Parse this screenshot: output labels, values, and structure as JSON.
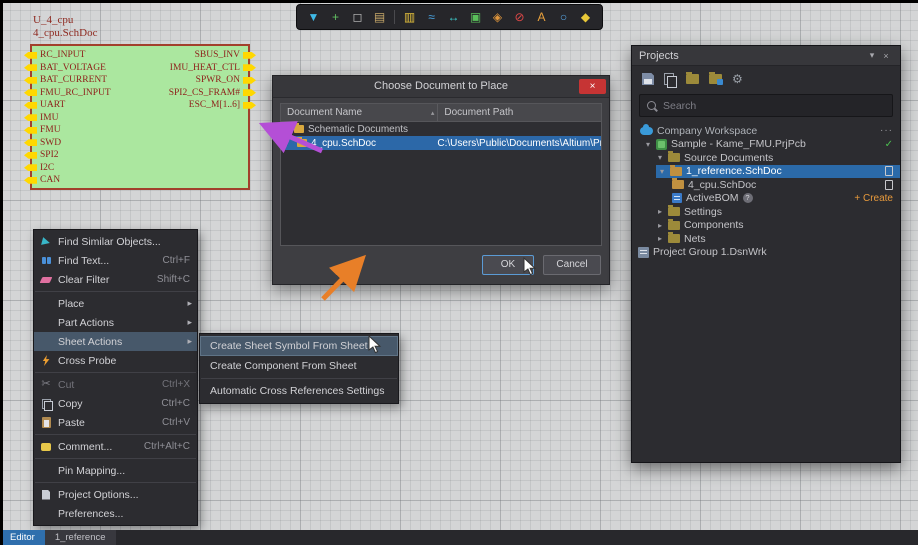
{
  "glyphs": {
    "submenu_arrow": "▸",
    "expanded": "▾",
    "collapsed": "▸",
    "sort": "▴",
    "close": "×",
    "panel_menu": "▾",
    "cut": "✂",
    "gear": "⚙"
  },
  "toolbar": {
    "icons": [
      {
        "name": "filter-icon",
        "glyph": "▼"
      },
      {
        "name": "wire-icon",
        "glyph": "+"
      },
      {
        "name": "selection-region-icon",
        "glyph": "◻"
      },
      {
        "name": "sheet-symbol-icon",
        "glyph": "▤"
      },
      {
        "name": "book-icon",
        "glyph": "▥"
      },
      {
        "name": "signal-harness-icon",
        "glyph": "≈"
      },
      {
        "name": "measure-icon",
        "glyph": "↔"
      },
      {
        "name": "new-sheet-icon",
        "glyph": "▣"
      },
      {
        "name": "tag-icon",
        "glyph": "◈"
      },
      {
        "name": "no-erc-icon",
        "glyph": "⊘"
      },
      {
        "name": "text-string-icon",
        "glyph": "A"
      },
      {
        "name": "ellipse-icon",
        "glyph": "○"
      },
      {
        "name": "polygon-icon",
        "glyph": "◆"
      }
    ]
  },
  "sheet_symbol": {
    "designator": "U_4_cpu",
    "filename": "4_cpu.SchDoc",
    "left_pins": [
      "RC_INPUT",
      "BAT_VOLTAGE",
      "BAT_CURRENT",
      "FMU_RC_INPUT",
      "UART",
      "IMU",
      "FMU",
      "SWD",
      "SPI2",
      "I2C",
      "CAN"
    ],
    "right_pins": [
      "SBUS_INV",
      "IMU_HEAT_CTL",
      "SPWR_ON",
      "SPI2_CS_FRAM#",
      "ESC_M[1..6]"
    ]
  },
  "dialog": {
    "title": "Choose Document to Place",
    "columns": [
      "Document Name",
      "Document Path"
    ],
    "group_row": "Schematic Documents",
    "row": {
      "name": "4_cpu.SchDoc",
      "path": "C:\\Users\\Public\\Documents\\Altium\\Projec"
    },
    "ok": "OK",
    "cancel": "Cancel"
  },
  "context_menu": {
    "items": [
      {
        "label": "Find Similar Objects...",
        "shortcut": ""
      },
      {
        "label": "Find Text...",
        "shortcut": "Ctrl+F"
      },
      {
        "label": "Clear Filter",
        "shortcut": "Shift+C"
      },
      {
        "label": "Place",
        "shortcut": ""
      },
      {
        "label": "Part Actions",
        "shortcut": ""
      },
      {
        "label": "Sheet Actions",
        "shortcut": ""
      },
      {
        "label": "Cross Probe",
        "shortcut": ""
      },
      {
        "label": "Cut",
        "shortcut": "Ctrl+X"
      },
      {
        "label": "Copy",
        "shortcut": "Ctrl+C"
      },
      {
        "label": "Paste",
        "shortcut": "Ctrl+V"
      },
      {
        "label": "Comment...",
        "shortcut": "Ctrl+Alt+C"
      },
      {
        "label": "Pin Mapping...",
        "shortcut": ""
      },
      {
        "label": "Project Options...",
        "shortcut": ""
      },
      {
        "label": "Preferences...",
        "shortcut": ""
      }
    ]
  },
  "submenu": {
    "items": [
      {
        "label": "Create Sheet Symbol From Sheet"
      },
      {
        "label": "Create Component From Sheet"
      },
      {
        "label": "Automatic Cross References Settings"
      }
    ]
  },
  "projects_panel": {
    "title": "Projects",
    "search_placeholder": "Search",
    "tree": [
      {
        "label": "Company Workspace",
        "right": "···"
      },
      {
        "label": "Sample - Kame_FMU.PrjPcb",
        "right": "✓"
      },
      {
        "label": "Source Documents",
        "right": ""
      },
      {
        "label": "1_reference.SchDoc",
        "right": ""
      },
      {
        "label": "4_cpu.SchDoc",
        "right": ""
      },
      {
        "label": "ActiveBOM",
        "badge": "?",
        "right": "+ Create"
      },
      {
        "label": "Settings",
        "right": ""
      },
      {
        "label": "Components",
        "right": ""
      },
      {
        "label": "Nets",
        "right": ""
      },
      {
        "label": "Project Group 1.DsnWrk",
        "right": ""
      }
    ]
  },
  "status_bar": {
    "tabs": [
      "Editor",
      "1_reference"
    ]
  },
  "colors": {
    "sheet_fill": "#abe79f",
    "sheet_border": "#a2402c",
    "pin_fill": "#ffd800",
    "selection_blue": "#2c68a8",
    "tree_selection_blue": "#2b6aa9",
    "menu_highlight": "#47586a",
    "arrow_purple": "#b44fd6",
    "arrow_orange": "#e87f28",
    "check_green": "#4cc050",
    "create_orange": "#e89a3c",
    "close_red": "#c63434",
    "editor_tab_blue": "#2f6fad"
  }
}
